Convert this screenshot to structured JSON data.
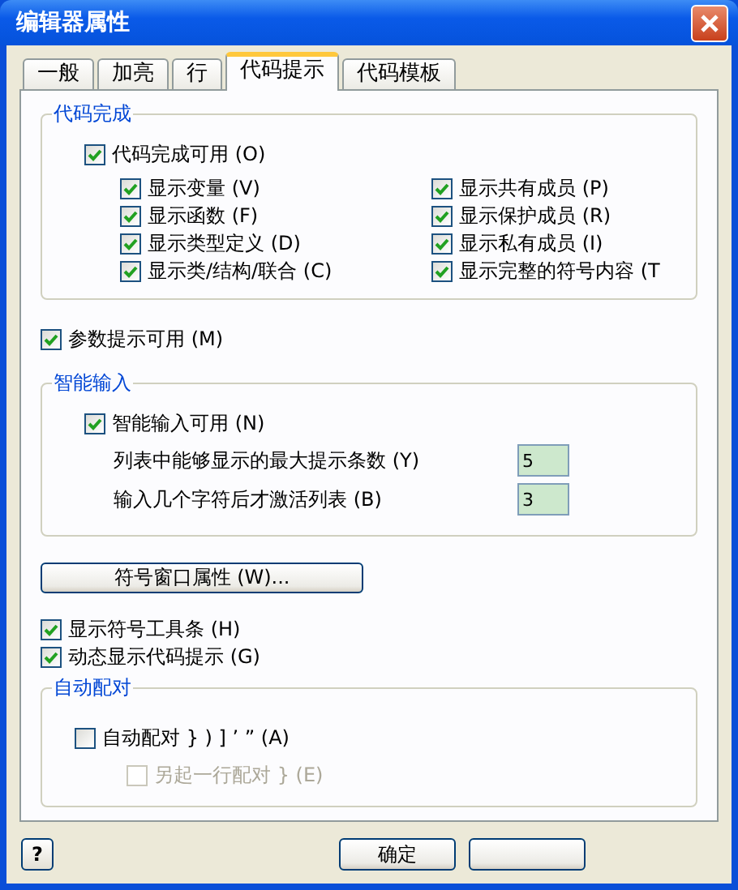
{
  "window": {
    "title": "编辑器属性"
  },
  "tabs": [
    {
      "label": "一般",
      "selected": false
    },
    {
      "label": "加亮",
      "selected": false
    },
    {
      "label": "行",
      "selected": false
    },
    {
      "label": "代码提示",
      "selected": true
    },
    {
      "label": "代码模板",
      "selected": false
    }
  ],
  "code_completion": {
    "title": "代码完成",
    "master": {
      "label": "代码完成可用 (O)",
      "checked": true
    },
    "options": [
      {
        "label": "显示变量 (V)",
        "checked": true
      },
      {
        "label": "显示共有成员 (P)",
        "checked": true
      },
      {
        "label": "显示函数 (F)",
        "checked": true
      },
      {
        "label": "显示保护成员 (R)",
        "checked": true
      },
      {
        "label": "显示类型定义 (D)",
        "checked": true
      },
      {
        "label": "显示私有成员 (I)",
        "checked": true
      },
      {
        "label": "显示类/结构/联合 (C)",
        "checked": true
      },
      {
        "label": "显示完整的符号内容 (T",
        "checked": true
      }
    ]
  },
  "param_hints": {
    "label": "参数提示可用 (M)",
    "checked": true
  },
  "smart_input": {
    "title": "智能输入",
    "master": {
      "label": "智能输入可用 (N)",
      "checked": true
    },
    "fields": [
      {
        "label": "列表中能够显示的最大提示条数 (Y)",
        "value": "5"
      },
      {
        "label": "输入几个字符后才激活列表 (B)",
        "value": "3"
      }
    ]
  },
  "symbol_window_button": "符号窗口属性 (W)...",
  "toolbar_options": [
    {
      "label": "显示符号工具条 (H)",
      "checked": true
    },
    {
      "label": "动态显示代码提示 (G)",
      "checked": true
    }
  ],
  "auto_pair": {
    "title": "自动配对",
    "master": {
      "label": "自动配对 } ) ] ’ ” (A)",
      "checked": false,
      "disabled": false
    },
    "sub": {
      "label": "另起一行配对 } (E)",
      "checked": false,
      "disabled": true
    }
  },
  "buttons": [
    {
      "kind": "help",
      "label": "?"
    },
    {
      "kind": "text",
      "label": "确定"
    },
    {
      "kind": "blank"
    }
  ]
}
